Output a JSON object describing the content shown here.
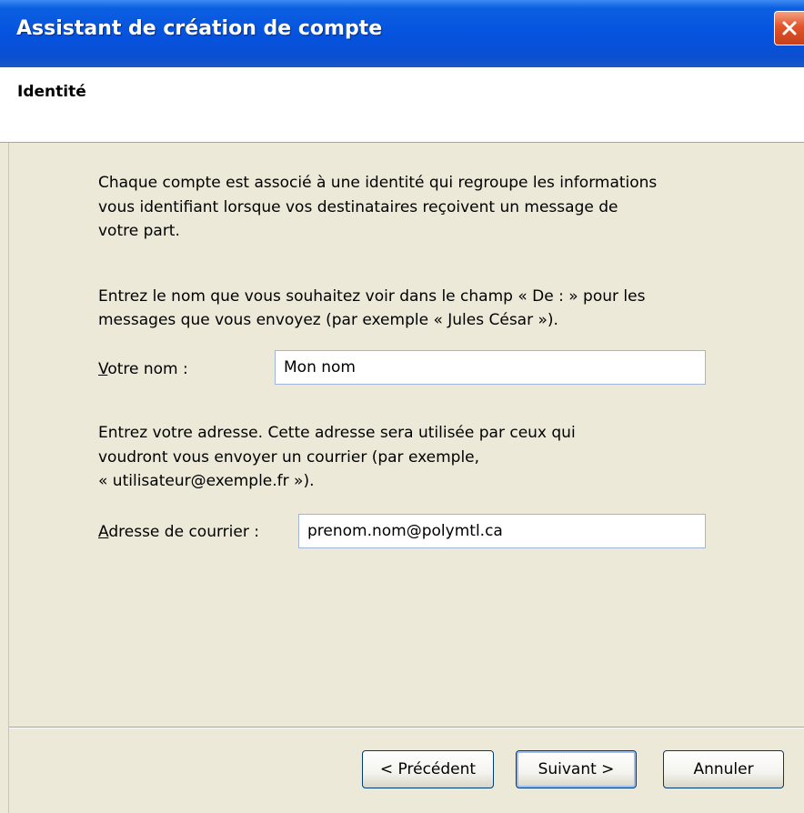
{
  "window": {
    "title": "Assistant de création de compte"
  },
  "header": {
    "title": "Identité"
  },
  "intro": {
    "line1": "Chaque compte est associé à une identité qui regroupe les informations",
    "line2": "vous identifiant lorsque vos destinataires reçoivent un message de",
    "line3": "votre part."
  },
  "name_instructions": {
    "line1": "Entrez le nom que vous souhaitez voir dans le champ « De : » pour les",
    "line2": "messages que vous envoyez (par exemple « Jules César »)."
  },
  "name_field": {
    "label_access_key": "V",
    "label_rest": "otre nom :",
    "value": "Mon nom"
  },
  "address_instructions": {
    "line1": "Entrez votre adresse. Cette adresse sera utilisée par ceux qui",
    "line2": "voudront vous envoyer un courrier (par exemple,",
    "line3": "« utilisateur@exemple.fr »)."
  },
  "email_field": {
    "label_access_key": "A",
    "label_rest": "dresse de courrier :",
    "value": "prenom.nom@polymtl.ca"
  },
  "buttons": {
    "back": "< Précédent",
    "next": "Suivant >",
    "cancel": "Annuler"
  },
  "icons": {
    "close": "close-icon"
  },
  "colors": {
    "titlebar": "#0553df",
    "close_button": "#e2532a",
    "dialog_bg": "#ece9d8"
  }
}
